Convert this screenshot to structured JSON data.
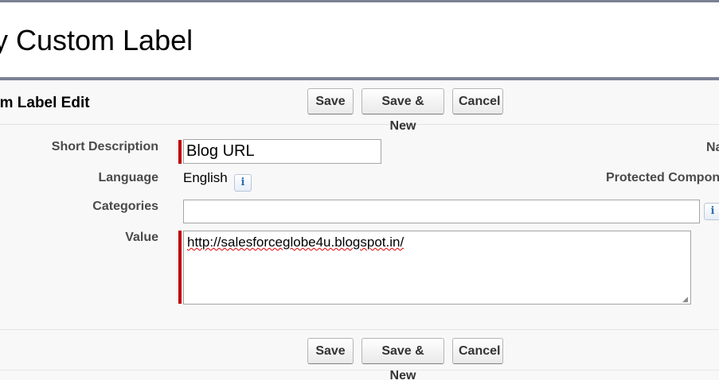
{
  "page": {
    "title": "y Custom Label"
  },
  "edit_panel": {
    "title": "om Label Edit"
  },
  "buttons": {
    "save": "Save",
    "save_new": "Save & New",
    "cancel": "Cancel"
  },
  "fields": {
    "short_description": {
      "label": "Short Description",
      "value": "Blog URL"
    },
    "language": {
      "label": "Language",
      "value": "English"
    },
    "categories": {
      "label": "Categories",
      "value": ""
    },
    "value": {
      "label": "Value",
      "text": "http://salesforceglobe4u.blogspot.in/"
    }
  },
  "right_column": {
    "name_label": "Na",
    "protected_label": "Protected Compon"
  },
  "icons": {
    "info": "info-icon",
    "info_glyph": "i"
  },
  "colors": {
    "required_bar": "#c00000",
    "accent_rule": "#7a8193",
    "panel_bg": "#f8f8f8"
  }
}
